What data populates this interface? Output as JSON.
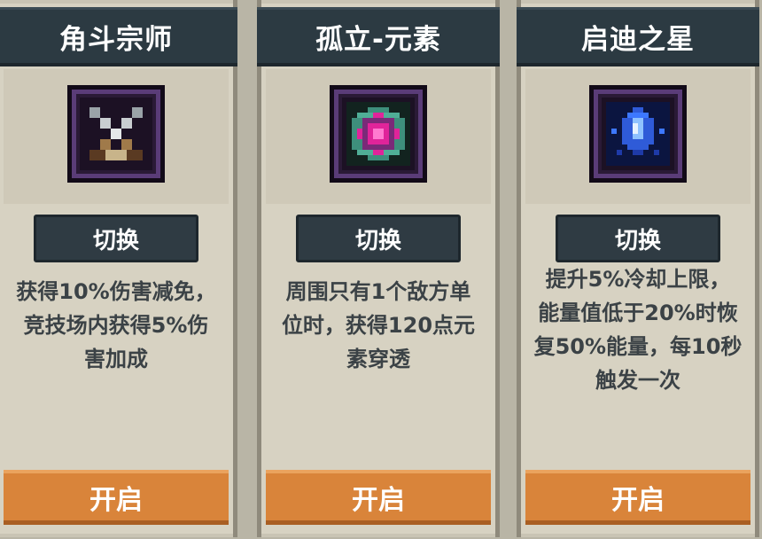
{
  "cards": [
    {
      "title": "角斗宗师",
      "icon": "crossed-swords-icon",
      "switch_label": "切换",
      "desc_lines": [
        "获得10%伤害减免，",
        "竞技场内获得5%伤",
        "害加成"
      ],
      "open_label": "开启"
    },
    {
      "title": "孤立-元素",
      "icon": "magenta-gem-icon",
      "switch_label": "切换",
      "desc_lines": [
        "周围只有1个敌方单",
        "位时，获得120点元",
        "素穿透"
      ],
      "open_label": "开启"
    },
    {
      "title": "启迪之星",
      "icon": "blue-star-crystal-icon",
      "switch_label": "切换",
      "desc_lines": [
        "提升5%冷却上限，",
        "能量值低于20%时恢",
        "复50%能量，每10秒",
        "触发一次"
      ],
      "open_label": "开启"
    }
  ],
  "colors": {
    "title_bar": "#2c3a42",
    "panel": "#d7d2c2",
    "open_button": "#d9843a",
    "text": "#3b4246"
  }
}
